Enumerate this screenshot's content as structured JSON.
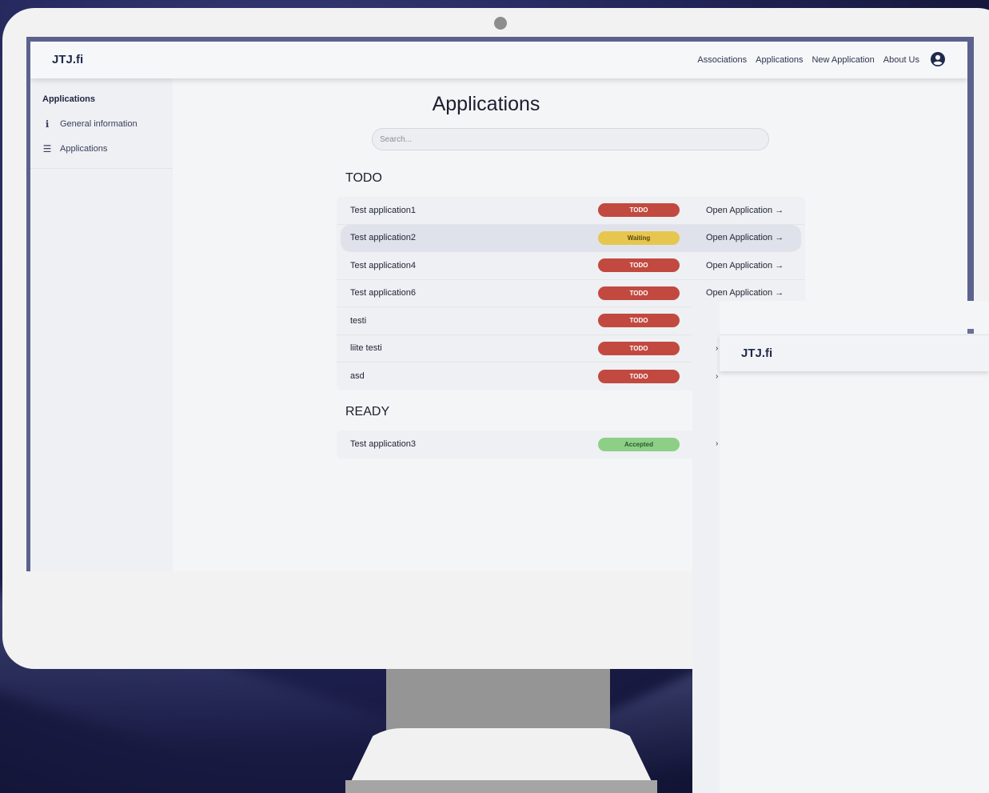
{
  "app": {
    "brand": "JTJ.fi"
  },
  "nav": {
    "links": [
      "Associations",
      "Applications",
      "New Application",
      "About Us"
    ],
    "user_icon": "user-circle-icon"
  },
  "sidebar": {
    "title": "Applications",
    "items": [
      {
        "icon": "info-icon",
        "label": "General information"
      },
      {
        "icon": "list-icon",
        "label": "Applications"
      }
    ]
  },
  "main": {
    "title": "Applications",
    "search_placeholder": "Search...",
    "sections": [
      {
        "title": "TODO",
        "rows": [
          {
            "name": "Test application1",
            "status": "TODO",
            "action": "Open Application"
          },
          {
            "name": "Test application2",
            "status": "Waiting",
            "action": "Open Application"
          },
          {
            "name": "Test application4",
            "status": "TODO",
            "action": "Open Application"
          },
          {
            "name": "Test application6",
            "status": "TODO",
            "action": "Open Application"
          },
          {
            "name": "testi",
            "status": "TODO"
          },
          {
            "name": "liite testi",
            "status": "TODO"
          },
          {
            "name": "asd",
            "status": "TODO"
          }
        ]
      },
      {
        "title": "READY",
        "rows": [
          {
            "name": "Test application3",
            "status": "Accepted"
          }
        ]
      }
    ]
  },
  "overlay": {
    "brand": "JTJ.fi"
  },
  "colors": {
    "todo": "#c2493f",
    "waiting": "#e6c64e",
    "accepted": "#8dcf86",
    "brand": "#1e2a4a"
  }
}
